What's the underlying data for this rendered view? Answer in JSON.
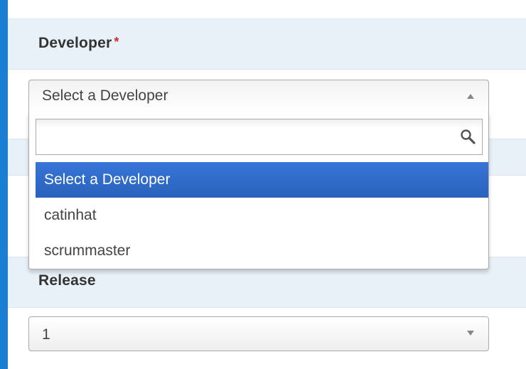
{
  "developer": {
    "label": "Developer",
    "required_mark": "*",
    "selected": "Select a Developer",
    "search": {
      "value": "",
      "placeholder": ""
    },
    "options": [
      {
        "label": "Select a Developer",
        "highlighted": true
      },
      {
        "label": "catinhat",
        "highlighted": false
      },
      {
        "label": "scrummaster",
        "highlighted": false
      }
    ]
  },
  "release": {
    "label": "Release",
    "selected": "1"
  },
  "icons": {
    "search": "search-icon",
    "dropdown_open": "chevron-up-icon",
    "dropdown_closed": "chevron-down-icon"
  },
  "colors": {
    "background": "#1a7fd4",
    "label_band": "#e8f0f8",
    "highlight": "#3875d7",
    "required": "#c9302c"
  }
}
